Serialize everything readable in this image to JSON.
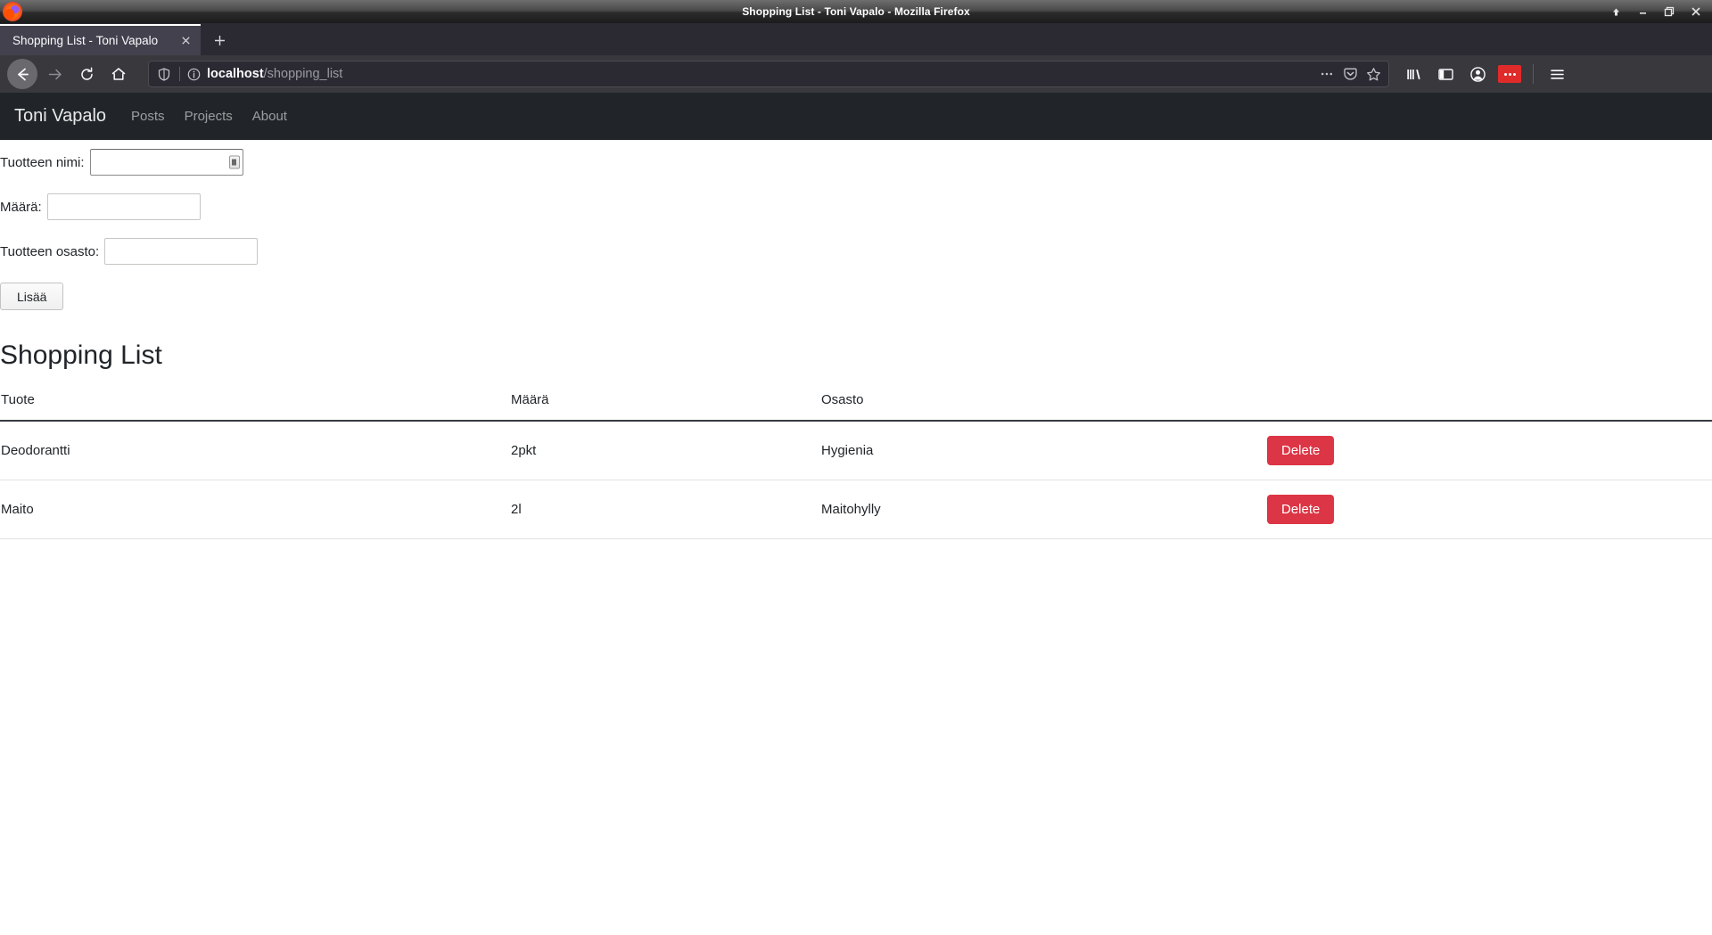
{
  "window": {
    "title": "Shopping List - Toni Vapalo - Mozilla Firefox",
    "controls": {
      "shade_label": "↑",
      "minimize_label": "—",
      "restore_label": "❐",
      "close_label": "✕"
    }
  },
  "browser": {
    "tab": {
      "title": "Shopping List - Toni Vapalo",
      "close_label": "✕"
    },
    "new_tab_label": "+",
    "urlbar": {
      "url_host": "localhost",
      "url_path": "/shopping_list",
      "page_actions_label": "•••"
    }
  },
  "site_nav": {
    "brand": "Toni Vapalo",
    "links": [
      {
        "label": "Posts"
      },
      {
        "label": "Projects"
      },
      {
        "label": "About"
      }
    ]
  },
  "form": {
    "fields": [
      {
        "label": "Tuotteen nimi:",
        "value": "",
        "placeholder": ""
      },
      {
        "label": "Määrä:",
        "value": "",
        "placeholder": ""
      },
      {
        "label": "Tuotteen osasto:",
        "value": "",
        "placeholder": ""
      }
    ],
    "submit_label": "Lisää"
  },
  "main": {
    "heading": "Shopping List",
    "table": {
      "columns": [
        "Tuote",
        "Määrä",
        "Osasto",
        ""
      ],
      "rows": [
        {
          "tuote": "Deodorantti",
          "maara": "2pkt",
          "osasto": "Hygienia",
          "action": "Delete"
        },
        {
          "tuote": "Maito",
          "maara": "2l",
          "osasto": "Maitohylly",
          "action": "Delete"
        }
      ]
    }
  },
  "colors": {
    "navbar_bg": "#212529",
    "danger": "#dc3545",
    "titlebar_text": "#ffffff",
    "table_header_rule": "#343a40"
  }
}
